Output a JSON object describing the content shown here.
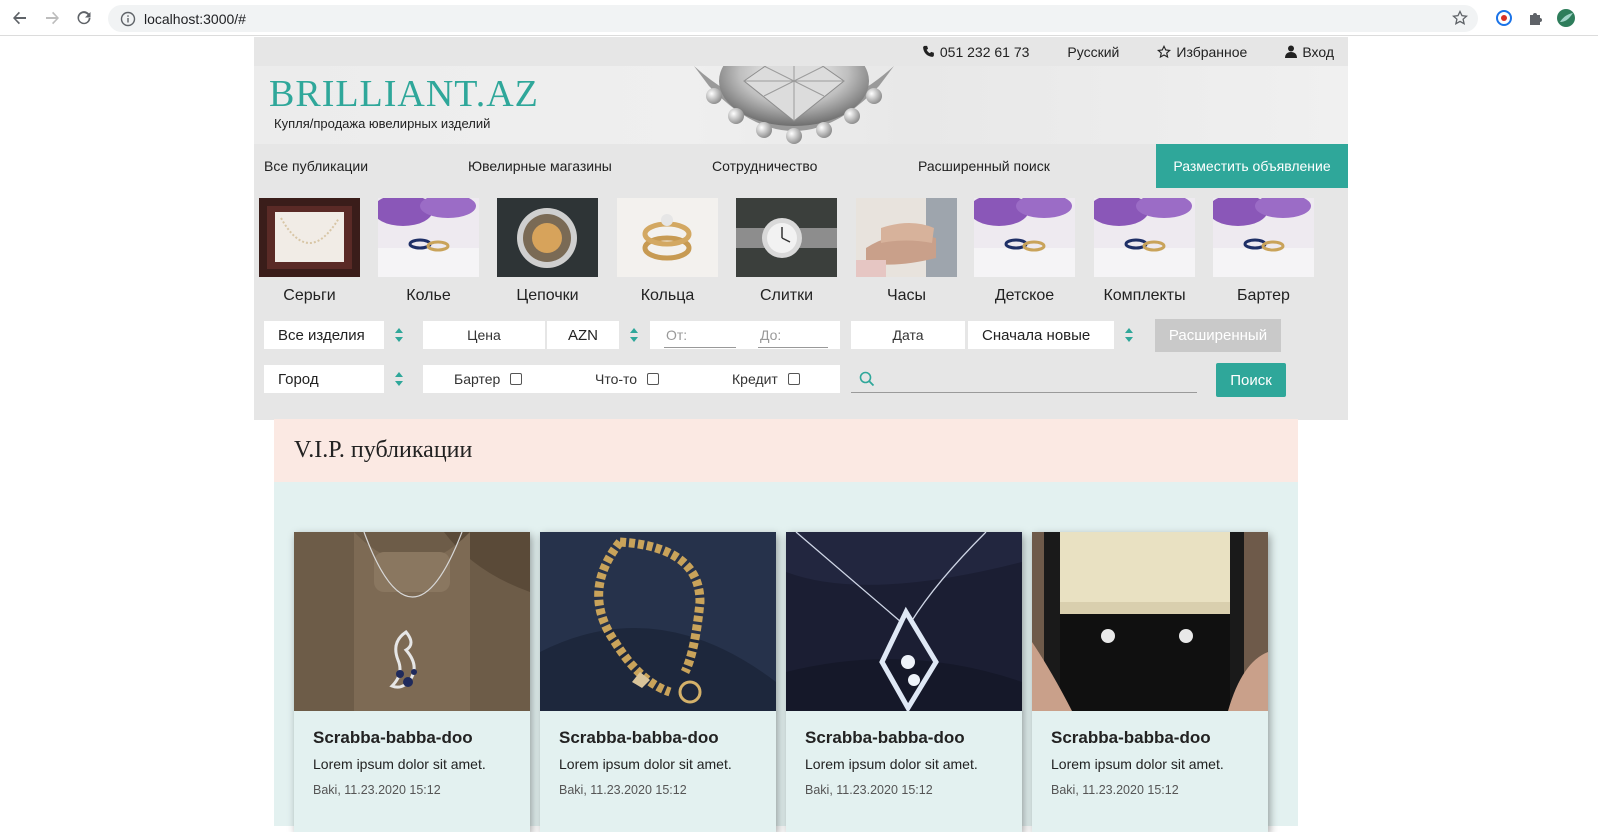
{
  "browser": {
    "url": "localhost:3000/#"
  },
  "topbar": {
    "phone": "051 232 61 73",
    "language": "Русский",
    "favorites": "Избранное",
    "login": "Вход"
  },
  "header": {
    "logo": "BRILLIANT.AZ",
    "tagline": "Купля/продажа ювелирных изделий"
  },
  "nav": {
    "items": [
      "Все публикации",
      "Ювелирные магазины",
      "Сотрудничество",
      "Расширенный поиск"
    ],
    "cta": "Разместить объявление"
  },
  "categories": [
    {
      "label": "Серьги",
      "theme": "necklace-box"
    },
    {
      "label": "Колье",
      "theme": "rings-lilac"
    },
    {
      "label": "Цепочки",
      "theme": "pocket-watch"
    },
    {
      "label": "Кольца",
      "theme": "gold-rings"
    },
    {
      "label": "Слитки",
      "theme": "wristwatch"
    },
    {
      "label": "Часы",
      "theme": "wedding-hands"
    },
    {
      "label": "Детское",
      "theme": "rings-lilac"
    },
    {
      "label": "Комплекты",
      "theme": "rings-lilac"
    },
    {
      "label": "Бартер",
      "theme": "rings-lilac"
    }
  ],
  "filters": {
    "product_type": "Все изделия",
    "price_label": "Цена",
    "currency": "AZN",
    "from_placeholder": "От:",
    "to_placeholder": "До:",
    "date_label": "Дата",
    "sort": "Сначала новые",
    "advanced_button": "Расширенный",
    "city": "Город",
    "barter": "Бартер",
    "something": "Что-то",
    "credit": "Кредит",
    "search_button": "Поиск"
  },
  "vip": {
    "heading": "V.I.P. публикации",
    "cards": [
      {
        "title": "Scrabba-babba-doo",
        "desc": "Lorem ipsum dolor sit amet.",
        "meta": "Baki, 11.23.2020 15:12",
        "image": "pendant-on-bust"
      },
      {
        "title": "Scrabba-babba-doo",
        "desc": "Lorem ipsum dolor sit amet.",
        "meta": "Baki, 11.23.2020 15:12",
        "image": "gold-bracelet"
      },
      {
        "title": "Scrabba-babba-doo",
        "desc": "Lorem ipsum dolor sit amet.",
        "meta": "Baki, 11.23.2020 15:12",
        "image": "diamond-pendant"
      },
      {
        "title": "Scrabba-babba-doo",
        "desc": "Lorem ipsum dolor sit amet.",
        "meta": "Baki, 11.23.2020 15:12",
        "image": "earrings-box"
      }
    ]
  },
  "colors": {
    "accent": "#2fa79a",
    "vip_header_bg": "#fbe9e3",
    "vip_body_bg": "#e3f1f0"
  }
}
